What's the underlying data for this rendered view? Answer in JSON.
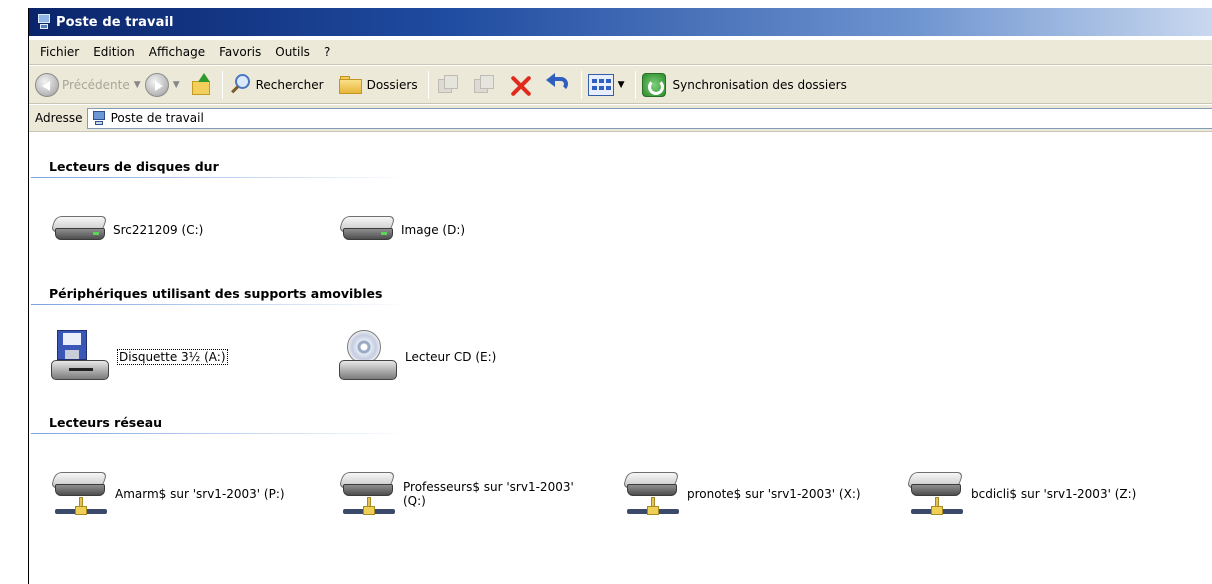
{
  "window": {
    "title": "Poste de travail"
  },
  "menu": [
    "Fichier",
    "Edition",
    "Affichage",
    "Favoris",
    "Outils",
    "?"
  ],
  "toolbar": {
    "back_label": "Précédente",
    "search_label": "Rechercher",
    "folders_label": "Dossiers",
    "sync_label": "Synchronisation des dossiers"
  },
  "address": {
    "label": "Adresse",
    "value": "Poste de travail"
  },
  "groups": {
    "hard_drives": {
      "title": "Lecteurs de disques dur",
      "items": [
        {
          "label": "Src221209 (C:)",
          "icon": "hard-drive-icon"
        },
        {
          "label": "Image (D:)",
          "icon": "hard-drive-icon"
        }
      ]
    },
    "removable": {
      "title": "Périphériques utilisant des supports amovibles",
      "items": [
        {
          "label": "Disquette 3½ (A:)",
          "icon": "floppy-drive-icon",
          "selected": true
        },
        {
          "label": "Lecteur CD (E:)",
          "icon": "cd-drive-icon"
        }
      ]
    },
    "network": {
      "title": "Lecteurs réseau",
      "items": [
        {
          "label": "Amarm$ sur 'srv1-2003' (P:)",
          "icon": "network-drive-icon"
        },
        {
          "label": "Professeurs$ sur 'srv1-2003' (Q:)",
          "icon": "network-drive-icon"
        },
        {
          "label": "pronote$ sur 'srv1-2003' (X:)",
          "icon": "network-drive-icon"
        },
        {
          "label": "bcdicli$ sur 'srv1-2003' (Z:)",
          "icon": "network-drive-icon"
        }
      ]
    }
  }
}
